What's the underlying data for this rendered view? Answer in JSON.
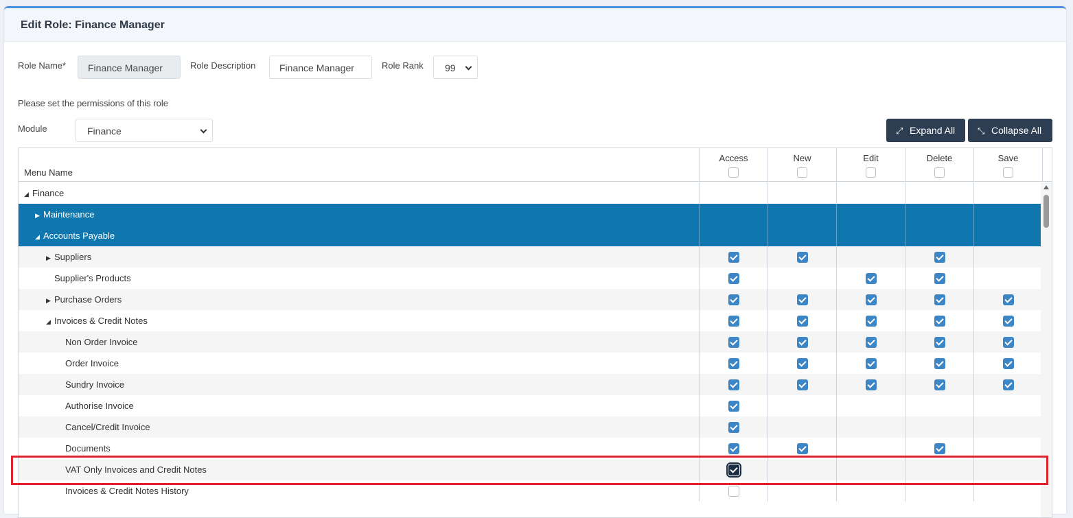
{
  "page": {
    "title": "Edit Role: Finance Manager"
  },
  "form": {
    "role_name_label": "Role Name*",
    "role_name_value": "Finance Manager",
    "role_description_label": "Role Description",
    "role_description_value": "Finance Manager",
    "role_rank_label": "Role Rank",
    "role_rank_value": "99",
    "permissions_hint": "Please set the permissions of this role",
    "module_label": "Module",
    "module_value": "Finance"
  },
  "buttons": {
    "expand_all": "Expand All",
    "collapse_all": "Collapse All"
  },
  "grid": {
    "menu_header": "Menu Name",
    "columns": [
      "Access",
      "New",
      "Edit",
      "Delete",
      "Save"
    ],
    "rows": [
      {
        "name": "Finance",
        "level": 0,
        "toggle": "expanded",
        "style": "plain",
        "perms": [
          false,
          false,
          false,
          false,
          false
        ]
      },
      {
        "name": "Maintenance",
        "level": 1,
        "toggle": "collapsed",
        "style": "blue",
        "perms": [
          false,
          false,
          false,
          false,
          false
        ]
      },
      {
        "name": "Accounts Payable",
        "level": 1,
        "toggle": "expanded",
        "style": "blue",
        "perms": [
          false,
          false,
          false,
          false,
          false
        ]
      },
      {
        "name": "Suppliers",
        "level": 2,
        "toggle": "collapsed",
        "style": "alt",
        "perms": [
          true,
          true,
          false,
          true,
          false
        ]
      },
      {
        "name": "Supplier's Products",
        "level": 2,
        "toggle": "none",
        "style": "plain",
        "perms": [
          true,
          false,
          true,
          true,
          false
        ]
      },
      {
        "name": "Purchase Orders",
        "level": 2,
        "toggle": "collapsed",
        "style": "alt",
        "perms": [
          true,
          true,
          true,
          true,
          true
        ]
      },
      {
        "name": "Invoices & Credit Notes",
        "level": 2,
        "toggle": "expanded",
        "style": "plain",
        "perms": [
          true,
          true,
          true,
          true,
          true
        ]
      },
      {
        "name": "Non Order Invoice",
        "level": 3,
        "toggle": "none",
        "style": "alt",
        "perms": [
          true,
          true,
          true,
          true,
          true
        ]
      },
      {
        "name": "Order Invoice",
        "level": 3,
        "toggle": "none",
        "style": "plain",
        "perms": [
          true,
          true,
          true,
          true,
          true
        ]
      },
      {
        "name": "Sundry Invoice",
        "level": 3,
        "toggle": "none",
        "style": "alt",
        "perms": [
          true,
          true,
          true,
          true,
          true
        ]
      },
      {
        "name": "Authorise Invoice",
        "level": 3,
        "toggle": "none",
        "style": "plain",
        "perms": [
          true,
          false,
          false,
          false,
          false
        ]
      },
      {
        "name": "Cancel/Credit Invoice",
        "level": 3,
        "toggle": "none",
        "style": "alt",
        "perms": [
          true,
          false,
          false,
          false,
          false
        ]
      },
      {
        "name": "Documents",
        "level": 3,
        "toggle": "none",
        "style": "plain",
        "perms": [
          true,
          true,
          false,
          true,
          false
        ]
      },
      {
        "name": "VAT Only Invoices and Credit Notes",
        "level": 3,
        "toggle": "none",
        "style": "alt",
        "focused": true,
        "perms": [
          true,
          false,
          false,
          false,
          false
        ]
      },
      {
        "name": "Invoices & Credit Notes History",
        "level": 3,
        "toggle": "none",
        "style": "plain",
        "unchecked_access": true,
        "perms": [
          false,
          false,
          false,
          false,
          false
        ]
      }
    ]
  },
  "colors": {
    "accent": "#4a90e2",
    "row_highlight": "#0f77ad",
    "checkbox": "#3d86c6",
    "annotation": "#e0222c",
    "button": "#2e3e52"
  }
}
